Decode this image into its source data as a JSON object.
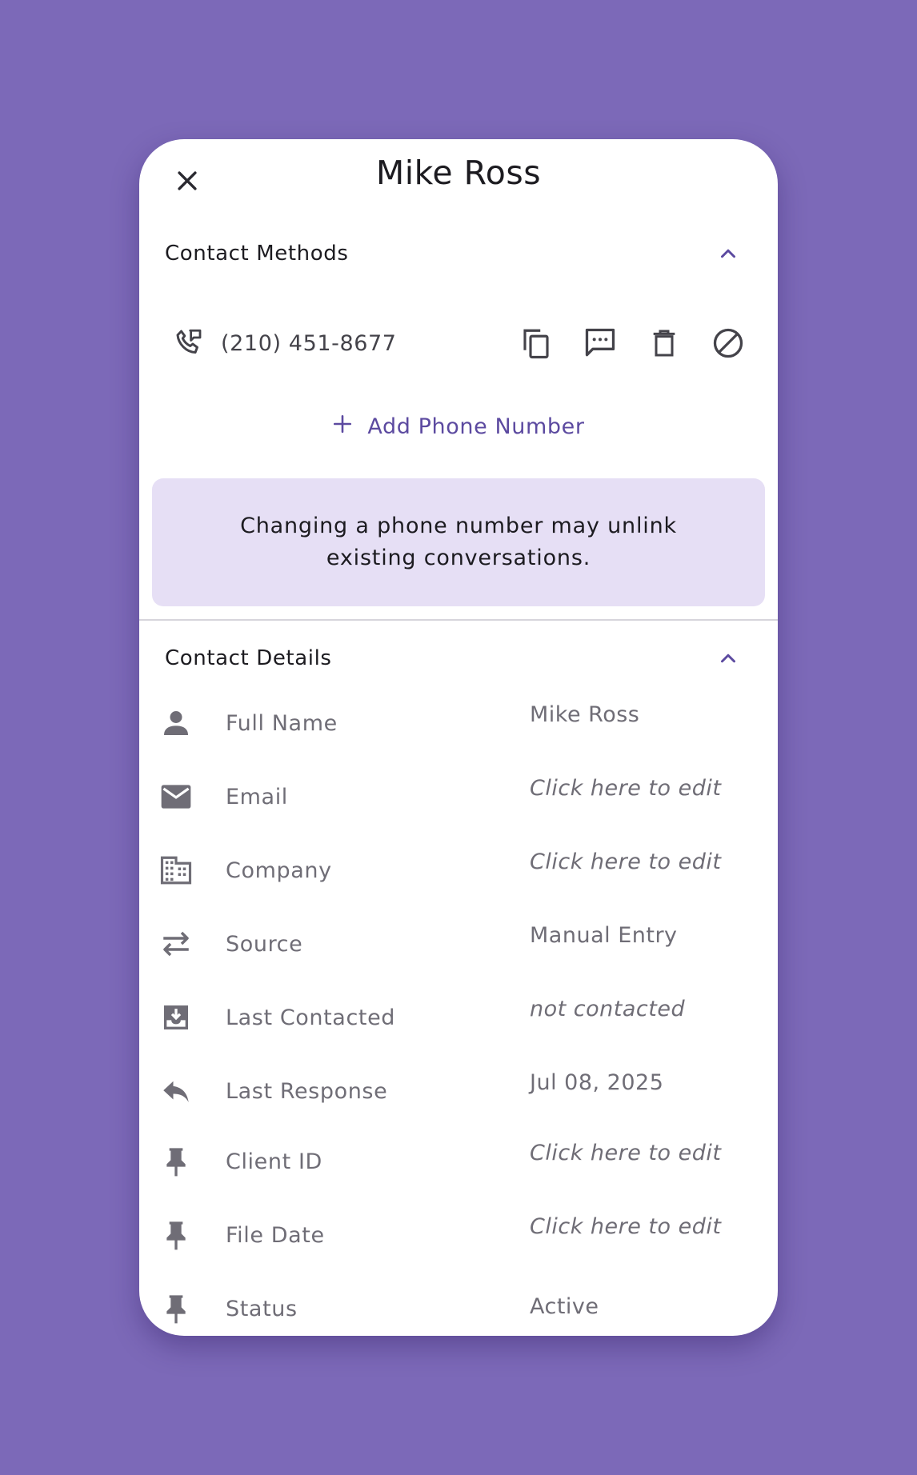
{
  "contact": {
    "name": "Mike Ross"
  },
  "contact_methods": {
    "title": "Contact Methods",
    "phone": "(210) 451-8677",
    "add_label": "Add Phone Number",
    "notice": "Changing a phone number may unlink existing conversations."
  },
  "contact_details": {
    "title": "Contact Details",
    "rows": [
      {
        "icon": "person-icon",
        "label": "Full Name",
        "value": "Mike Ross"
      },
      {
        "icon": "email-icon",
        "label": "Email",
        "value": "Click here to edit"
      },
      {
        "icon": "company-icon",
        "label": "Company",
        "value": "Click here to edit"
      },
      {
        "icon": "source-icon",
        "label": "Source",
        "value": "Manual Entry"
      },
      {
        "icon": "inbox-icon",
        "label": "Last Contacted",
        "value": "not contacted"
      },
      {
        "icon": "reply-icon",
        "label": "Last Response",
        "value": "Jul 08, 2025"
      },
      {
        "icon": "pin-icon",
        "label": "Client ID",
        "value": "Click here to edit"
      },
      {
        "icon": "pin-icon",
        "label": "File Date",
        "value": "Click here to edit"
      },
      {
        "icon": "pin-icon",
        "label": "Status",
        "value": "Active"
      }
    ]
  },
  "colors": {
    "background": "#7c69b8",
    "accent": "#5c4aa0",
    "notice_bg": "#e6dff5",
    "muted_text": "#6f6d76"
  }
}
